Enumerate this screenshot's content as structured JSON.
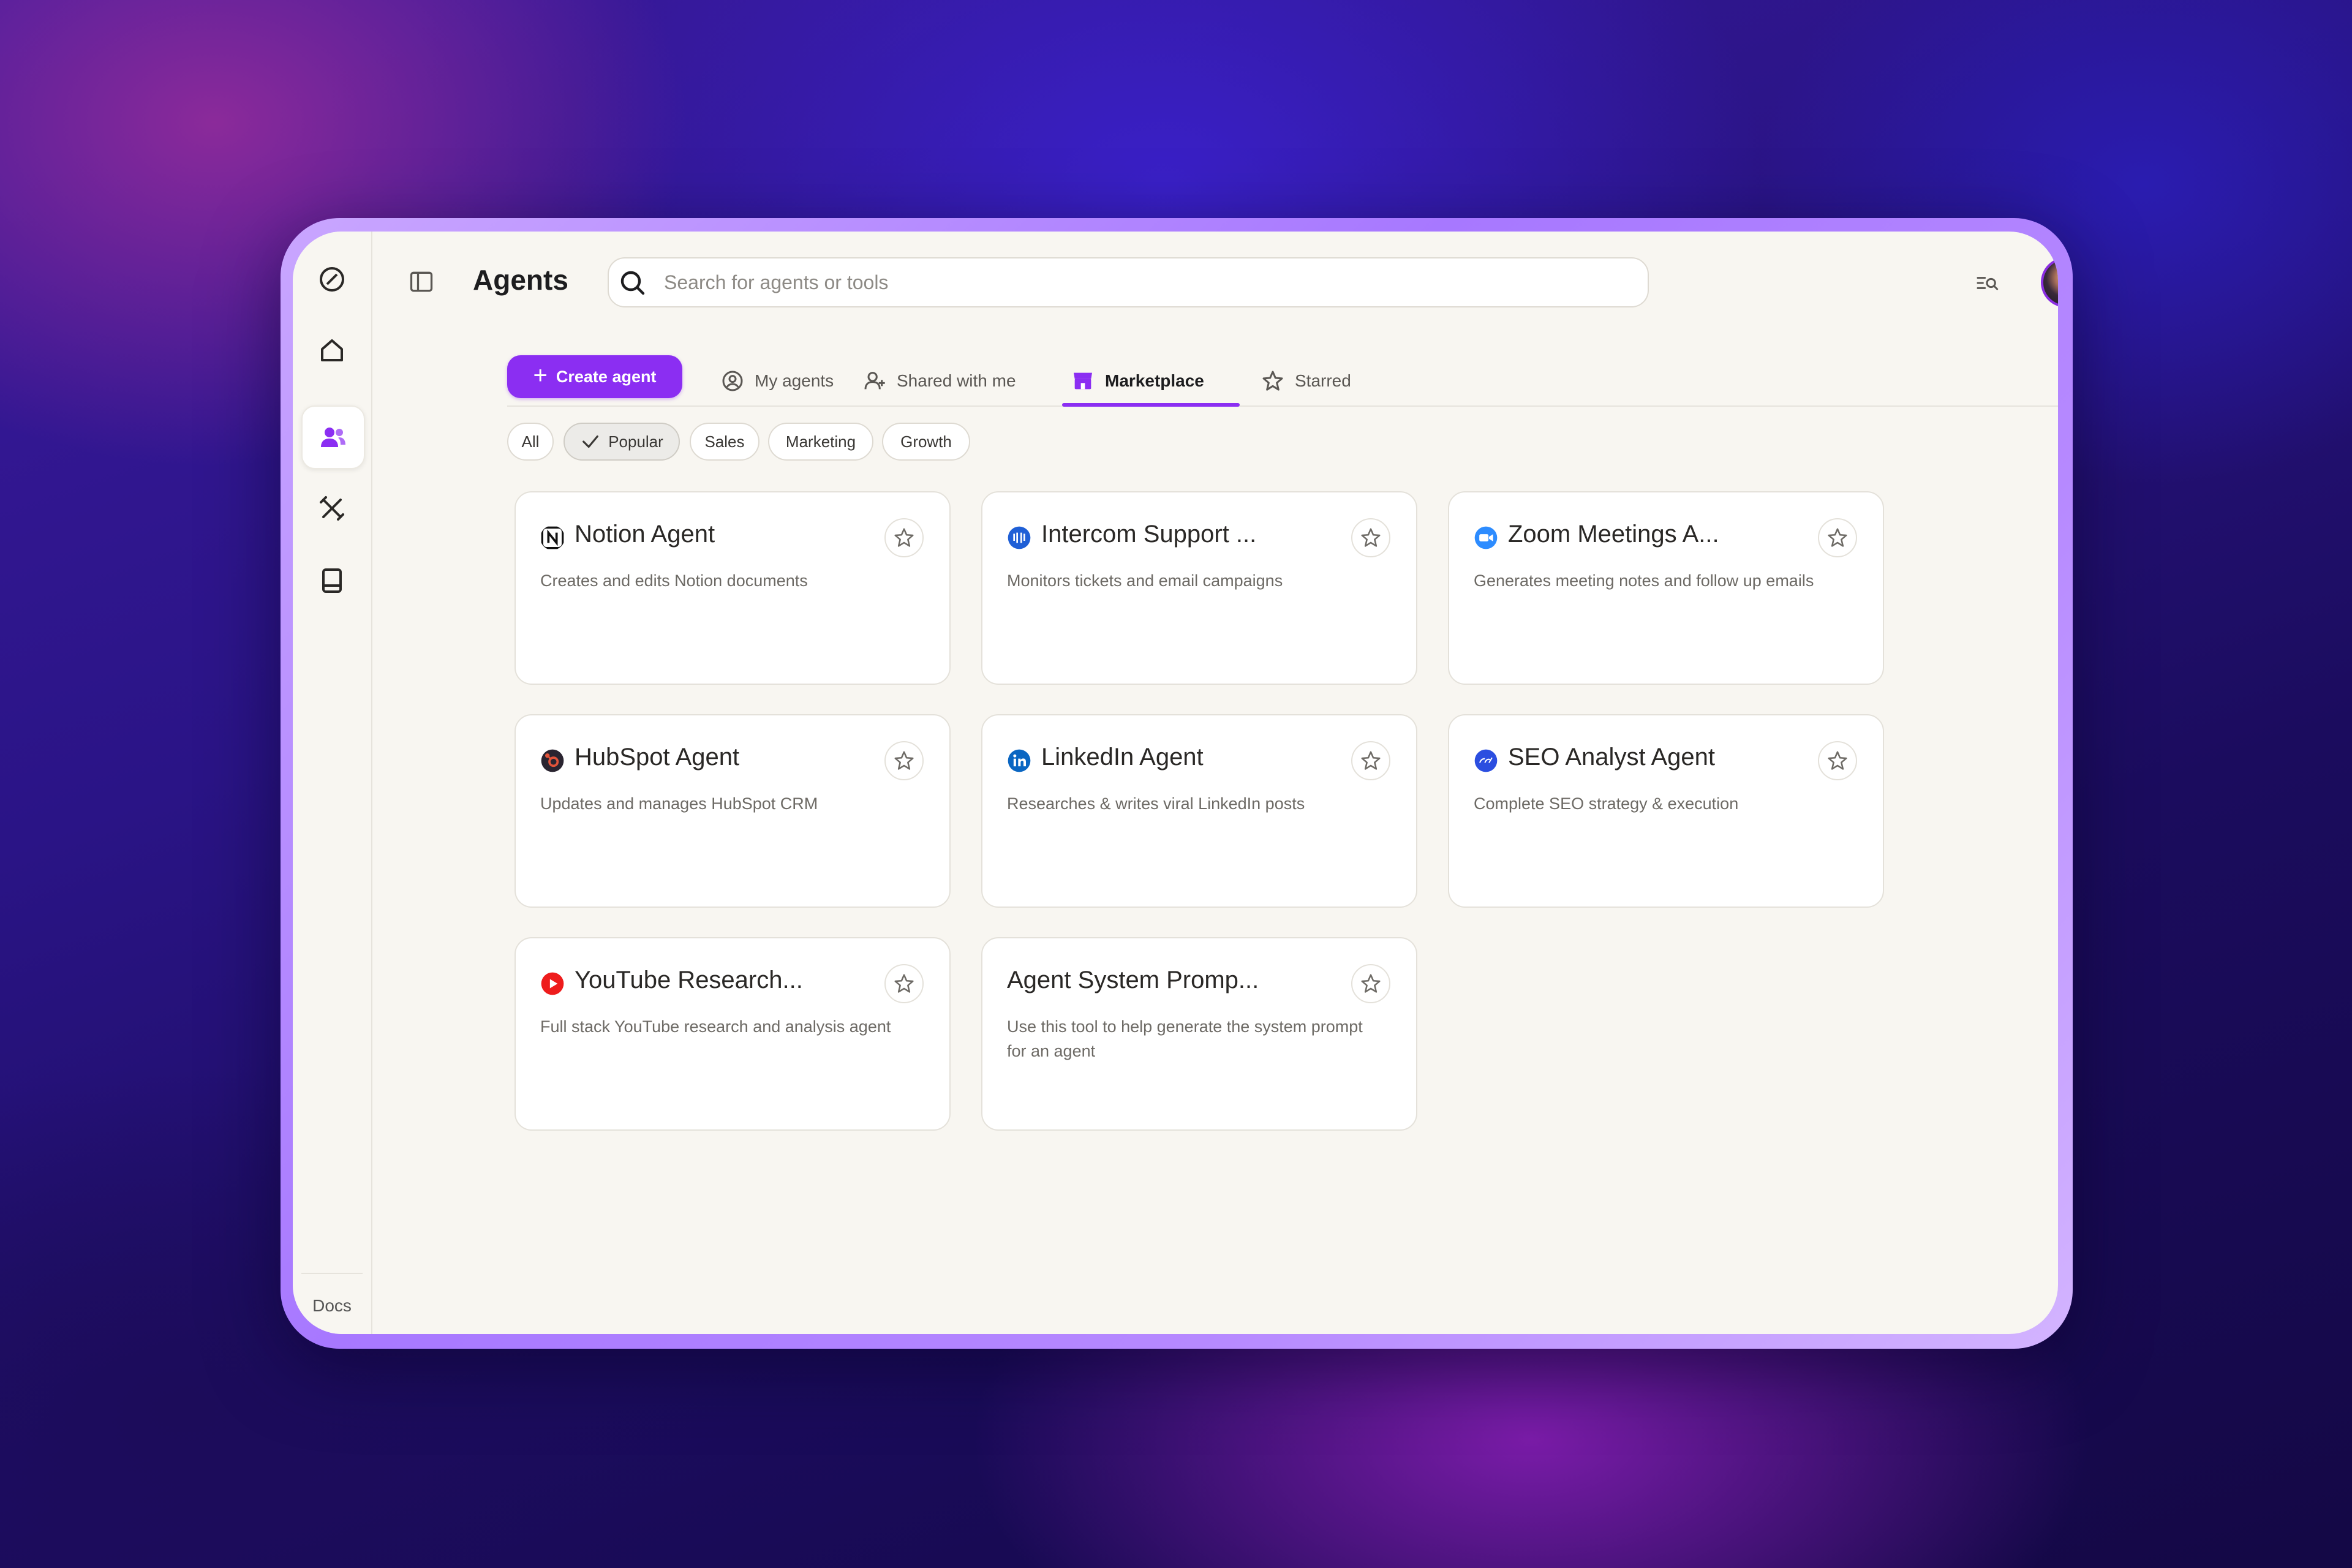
{
  "app": {
    "title": "Agents",
    "search_placeholder": "Search for agents or tools",
    "docs_label": "Docs",
    "accent_color": "#8b2ef2"
  },
  "sidebar": {
    "items": [
      {
        "icon": "logo-icon"
      },
      {
        "icon": "home-icon"
      },
      {
        "icon": "users-icon",
        "active": true
      },
      {
        "icon": "tools-icon"
      },
      {
        "icon": "book-icon"
      }
    ]
  },
  "tabs": {
    "create_label": "Create agent",
    "items": [
      {
        "label": "My agents",
        "icon": "user-circle-icon"
      },
      {
        "label": "Shared with me",
        "icon": "user-share-icon"
      },
      {
        "label": "Marketplace",
        "icon": "store-icon",
        "active": true
      },
      {
        "label": "Starred",
        "icon": "star-icon"
      }
    ]
  },
  "filters": [
    {
      "label": "All"
    },
    {
      "label": "Popular",
      "active": true
    },
    {
      "label": "Sales"
    },
    {
      "label": "Marketing"
    },
    {
      "label": "Growth"
    }
  ],
  "cards": [
    {
      "title": "Notion Agent",
      "desc": "Creates and edits Notion documents",
      "logo": "notion-logo-icon",
      "color": "#111111"
    },
    {
      "title": "Intercom Support ...",
      "desc": "Monitors tickets and email campaigns",
      "logo": "intercom-logo-icon",
      "color": "#1f5fd6"
    },
    {
      "title": "Zoom Meetings A...",
      "desc": "Generates meeting notes and follow up emails",
      "logo": "zoom-logo-icon",
      "color": "#2d8cff"
    },
    {
      "title": "HubSpot Agent",
      "desc": "Updates and manages HubSpot CRM",
      "logo": "hubspot-logo-icon",
      "color": "#e2533a"
    },
    {
      "title": "LinkedIn Agent",
      "desc": "Researches & writes viral LinkedIn posts",
      "logo": "linkedin-logo-icon",
      "color": "#0a66c2"
    },
    {
      "title": "SEO Analyst Agent",
      "desc": "Complete SEO strategy & execution",
      "logo": "ahrefs-logo-icon",
      "color": "#2b4ee0"
    },
    {
      "title": "YouTube Research...",
      "desc": "Full stack YouTube research and analysis agent",
      "logo": "youtube-logo-icon",
      "color": "#ee1c1c"
    },
    {
      "title": "Agent System Promp...",
      "desc": "Use this tool to help generate the system prompt for an agent",
      "logo": null
    }
  ]
}
